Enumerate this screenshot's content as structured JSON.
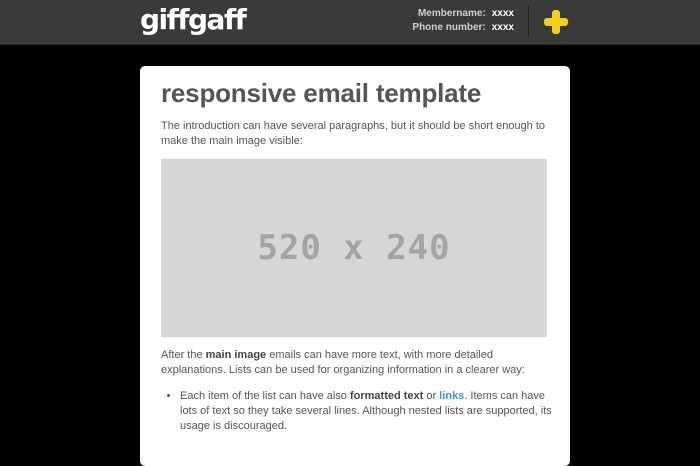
{
  "header": {
    "logo": "giffgaff",
    "membername_label": "Membername:",
    "membername_value": "xxxx",
    "phone_label": "Phone number:",
    "phone_value": "xxxx",
    "plus_icon": "plus-icon",
    "plus_color": "#f5d10f",
    "background": "#3a3a3a"
  },
  "email": {
    "title": "responsive email template",
    "intro": "The introduction can have several paragraphs, but it should be short enough to make the main image visible:",
    "image_placeholder": "520 x 240",
    "after_1": "After the ",
    "after_bold": "main image",
    "after_2": " emails can have more text, with more detailed explanations. Lists can be used for organizing information in a clearer way:",
    "list_items": [
      {
        "t1": "Each item of the list can have also ",
        "bold": "formatted text",
        "t2": " or ",
        "link": "links",
        "t3": ". Items can have lots of text so they take several lines. Although nested lists are supported, its usage is discouraged."
      }
    ],
    "link_color": "#3a9ad9"
  }
}
